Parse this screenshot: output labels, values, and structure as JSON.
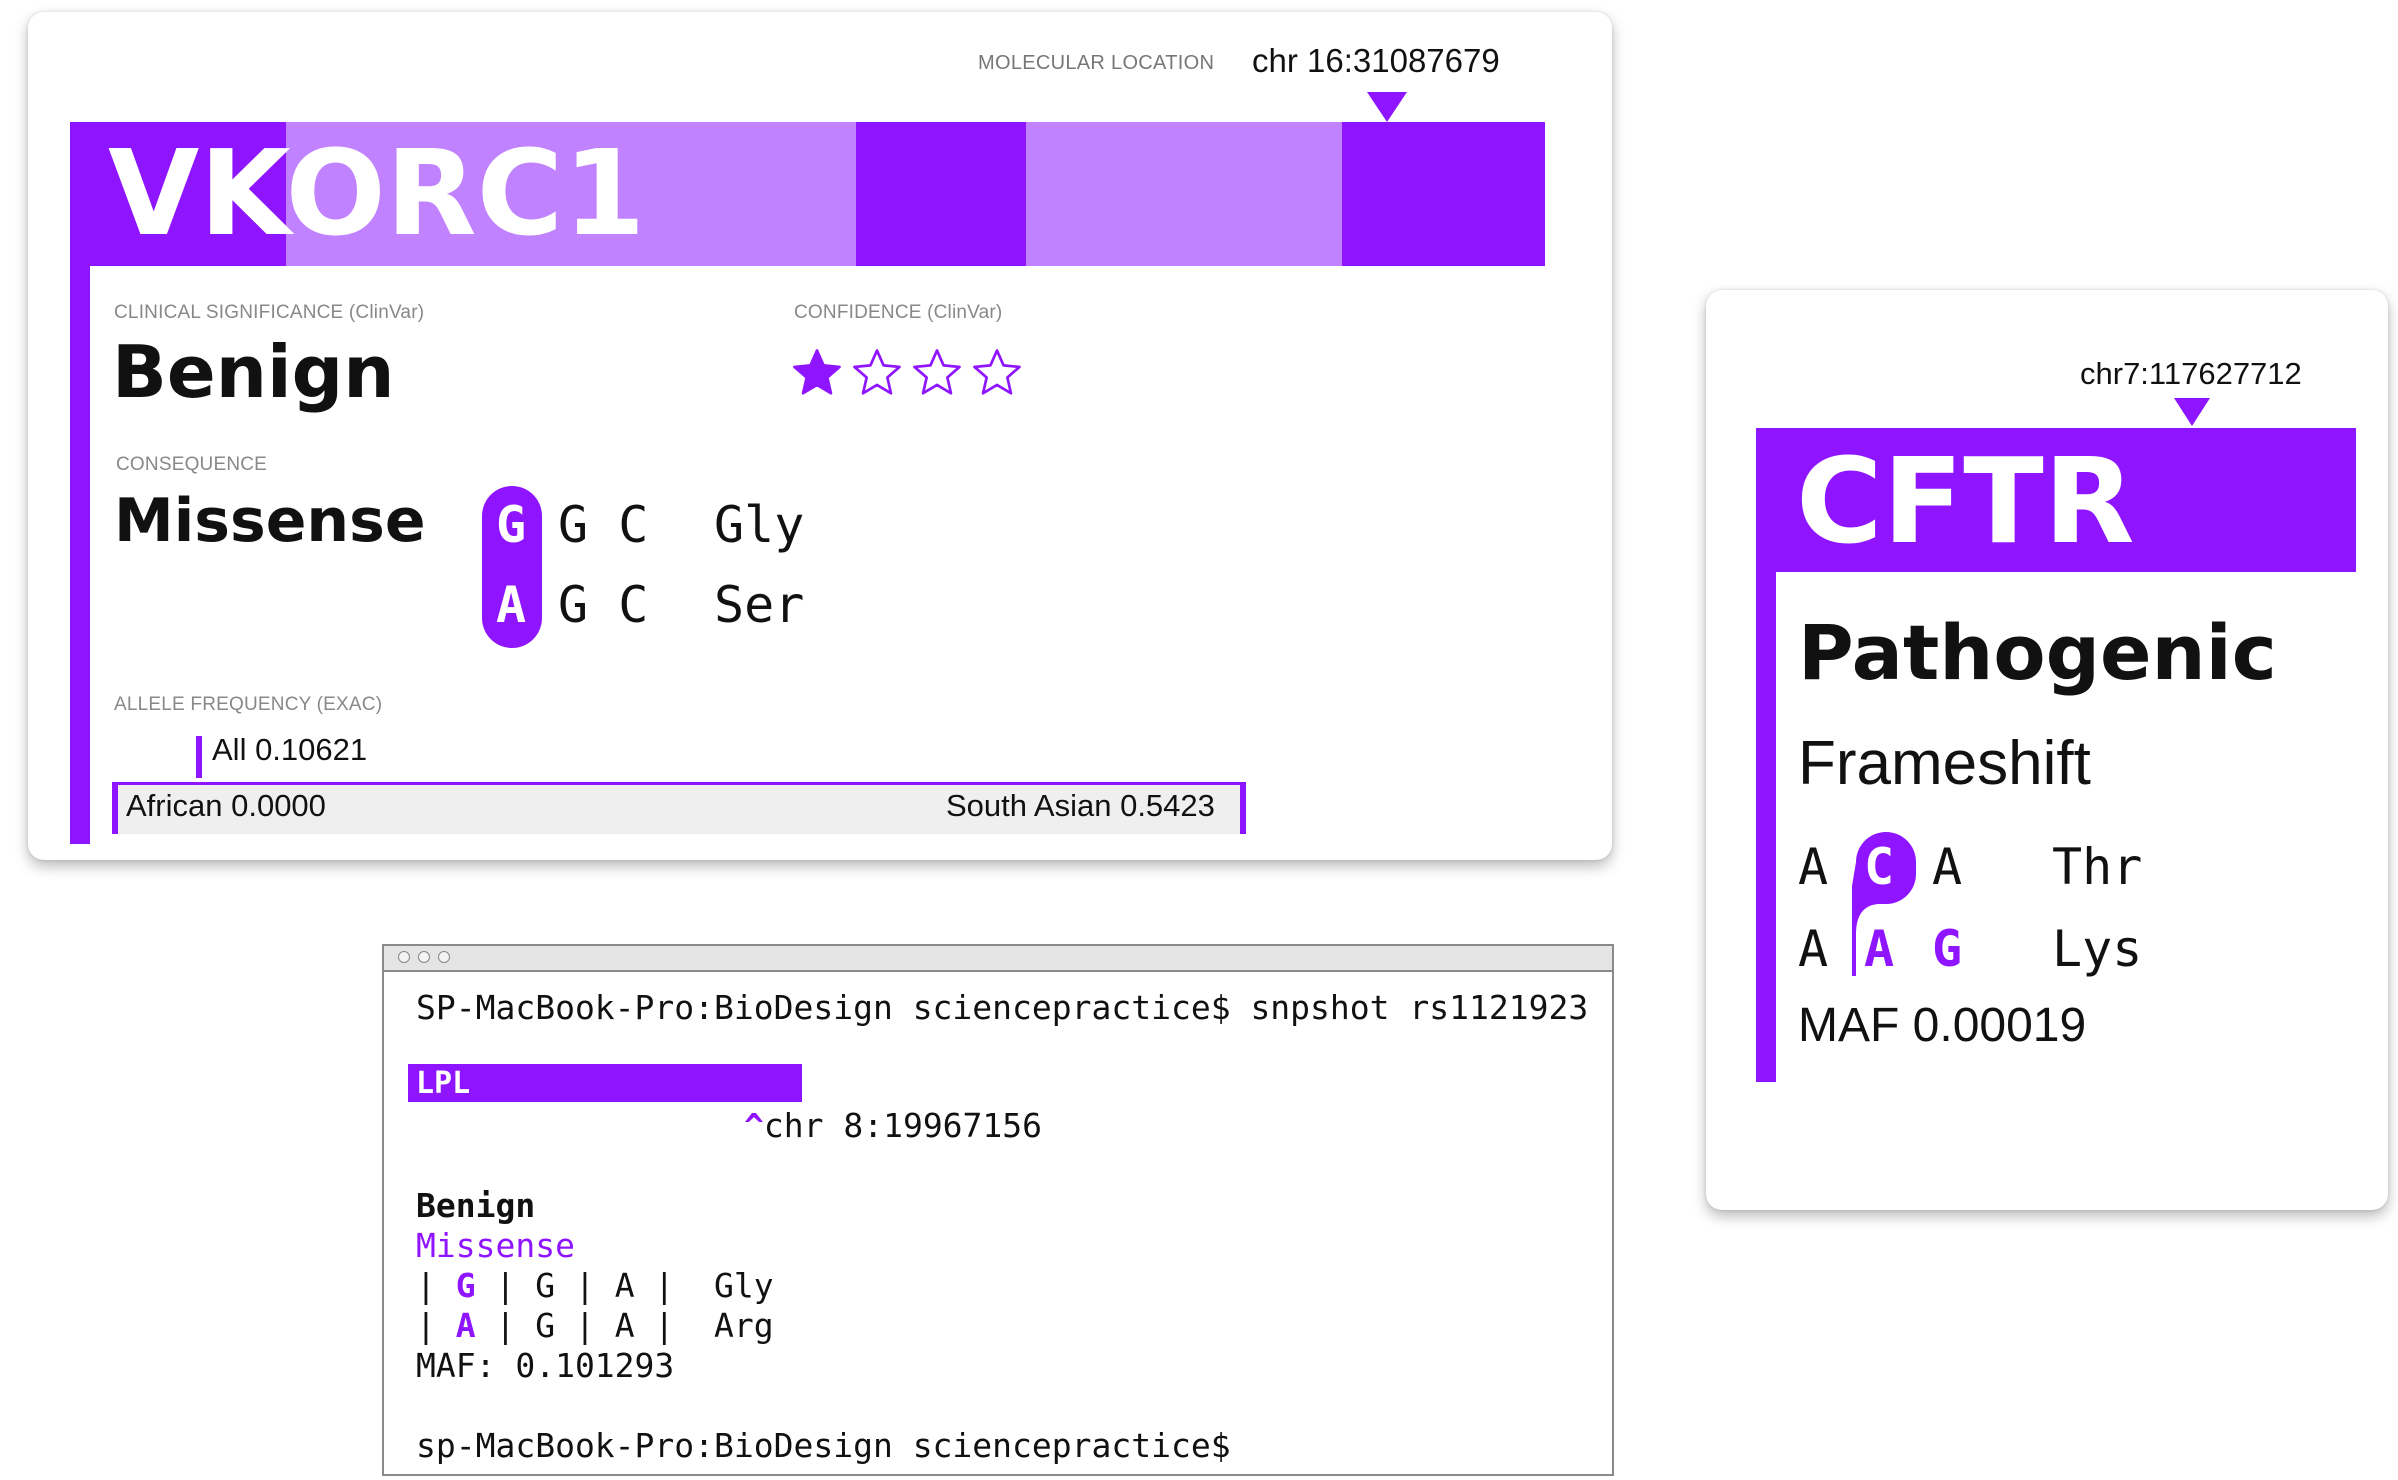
{
  "colors": {
    "accent": "#8f14ff",
    "accent_light": "#c182ff",
    "freq_bar": "#efefef"
  },
  "vkorc1": {
    "molecular_location_label": "MOLECULAR LOCATION",
    "molecular_location": "chr 16:31087679",
    "gene": "VKORC1",
    "clinical_significance_label": "CLINICAL SIGNIFICANCE (ClinVar)",
    "clinical_significance": "Benign",
    "confidence_label": "CONFIDENCE (ClinVar)",
    "confidence_stars": 1,
    "confidence_max": 4,
    "consequence_label": "CONSEQUENCE",
    "consequence": "Missense",
    "codon_ref": {
      "variant_base": "G",
      "rest": "G C",
      "amino_acid": "Gly"
    },
    "codon_alt": {
      "variant_base": "A",
      "rest": "G C",
      "amino_acid": "Ser"
    },
    "allele_frequency_label": "ALLELE FREQUENCY (EXAC)",
    "allele_all": "All 0.10621",
    "allele_min": "African 0.0000",
    "allele_max": "South Asian 0.5423"
  },
  "cftr": {
    "molecular_location": "chr7:117627712",
    "gene": "CFTR",
    "clinical_significance": "Pathogenic",
    "consequence": "Frameshift",
    "codon_ref": {
      "b1": "A",
      "b2": "C",
      "b3": "A",
      "amino_acid": "Thr"
    },
    "codon_alt": {
      "b1": "A",
      "b2": "A",
      "b3": "G",
      "amino_acid": "Lys"
    },
    "maf": "MAF 0.00019"
  },
  "terminal": {
    "command_line": "SP-MacBook-Pro:BioDesign sciencepractice$ snpshot rs1121923",
    "gene": "LPL",
    "location": "^chr 8:19967156",
    "clinical_significance": "Benign",
    "consequence": "Missense",
    "codon_ref": {
      "pre": "| ",
      "variant": "G",
      "post": " | G | A |  Gly"
    },
    "codon_alt": {
      "pre": "| ",
      "variant": "A",
      "post": " | G | A |  Arg"
    },
    "maf": "MAF: 0.101293",
    "prompt": "sp-MacBook-Pro:BioDesign sciencepractice$"
  }
}
